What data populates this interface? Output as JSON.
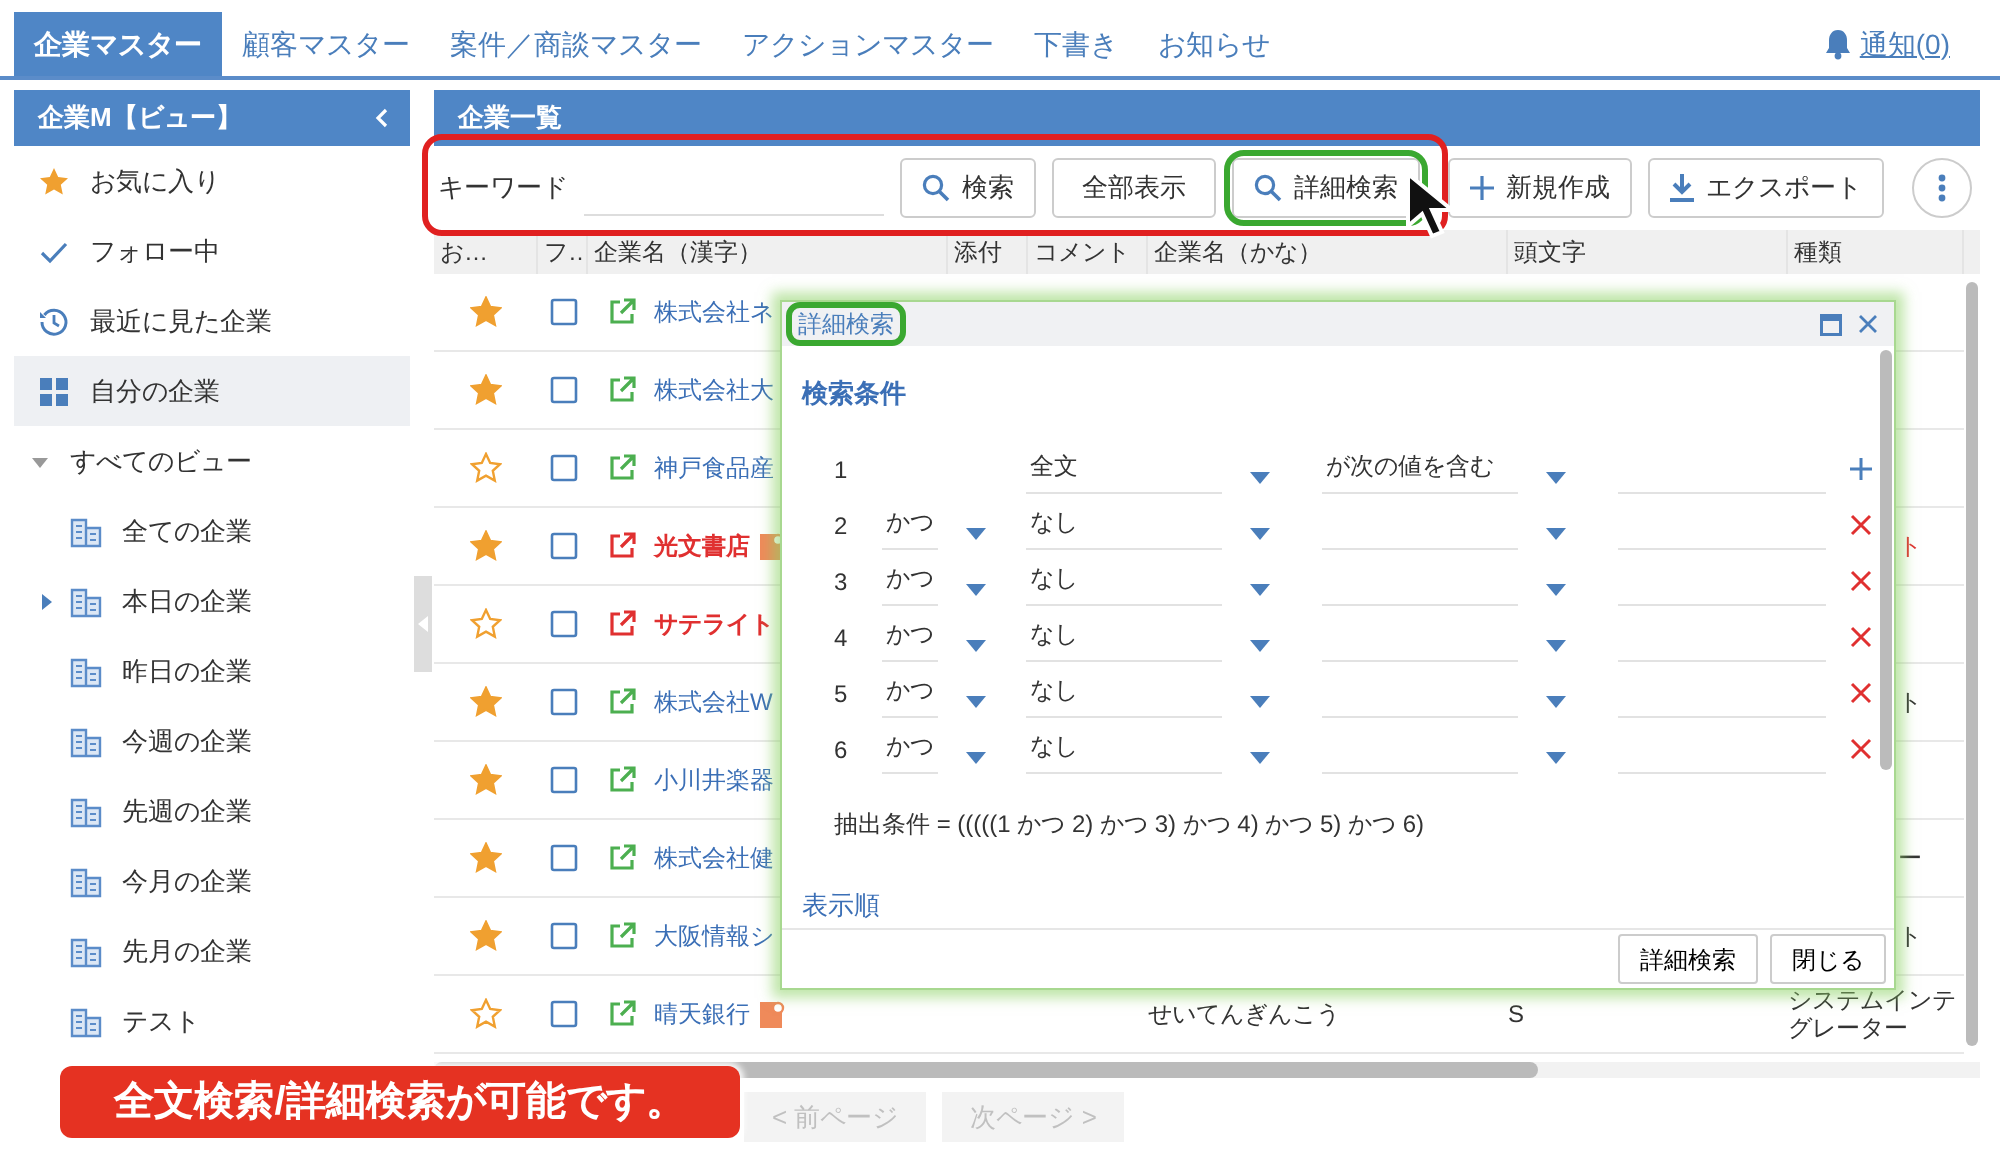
{
  "top_tabs": [
    {
      "label": "企業マスター",
      "selected": true
    },
    {
      "label": "顧客マスター",
      "selected": false
    },
    {
      "label": "案件／商談マスター",
      "selected": false
    },
    {
      "label": "アクションマスター",
      "selected": false
    },
    {
      "label": "下書き",
      "selected": false
    },
    {
      "label": "お知らせ",
      "selected": false
    }
  ],
  "notification": {
    "label": "通知(0)"
  },
  "sidebar": {
    "title": "企業M【ビュー】",
    "items": [
      {
        "label": "お気に入り",
        "kind": "favorites",
        "selected": false
      },
      {
        "label": "フォロー中",
        "kind": "following",
        "selected": false
      },
      {
        "label": "最近に見た企業",
        "kind": "recent",
        "selected": false
      },
      {
        "label": "自分の企業",
        "kind": "mine",
        "selected": true
      },
      {
        "label": "すべてのビュー",
        "kind": "group",
        "selected": false,
        "expanded": true,
        "children": [
          {
            "label": "全ての企業",
            "expandable": false,
            "selected": false
          },
          {
            "label": "本日の企業",
            "expandable": true,
            "selected": false
          },
          {
            "label": "昨日の企業",
            "expandable": false,
            "selected": false
          },
          {
            "label": "今週の企業",
            "expandable": false,
            "selected": false
          },
          {
            "label": "先週の企業",
            "expandable": false,
            "selected": false
          },
          {
            "label": "今月の企業",
            "expandable": false,
            "selected": false
          },
          {
            "label": "先月の企業",
            "expandable": false,
            "selected": false
          },
          {
            "label": "テスト",
            "expandable": false,
            "selected": false
          }
        ]
      }
    ]
  },
  "main": {
    "title": "企業一覧",
    "keyword_label": "キーワード",
    "toolbar": [
      {
        "label": "検索",
        "kind": "search"
      },
      {
        "label": "全部表示",
        "kind": "plain"
      },
      {
        "label": "詳細検索",
        "kind": "search"
      },
      {
        "label": "新規作成",
        "kind": "add"
      },
      {
        "label": "エクスポート",
        "kind": "export"
      }
    ],
    "table": {
      "columns": [
        "お…",
        "フ…",
        "企業名（漢字）",
        "添付",
        "コメント",
        "企業名（かな）",
        "頭文字",
        "種類"
      ],
      "rows": [
        {
          "favorite": true,
          "followed": false,
          "name": "株式会社ネ",
          "flagged": false
        },
        {
          "favorite": true,
          "followed": false,
          "name": "株式会社大",
          "flagged": false
        },
        {
          "favorite": false,
          "followed": false,
          "name": "神戸食品産",
          "flagged": false
        },
        {
          "favorite": true,
          "followed": false,
          "name": "光文書店",
          "flagged": true,
          "attachment": true,
          "type": "ト",
          "type_cut": true
        },
        {
          "favorite": false,
          "followed": false,
          "name": "サテライト",
          "flagged": true
        },
        {
          "favorite": true,
          "followed": false,
          "name": "株式会社W",
          "flagged": false,
          "type": "ト",
          "type_cut": true
        },
        {
          "favorite": true,
          "followed": false,
          "name": "小川井楽器",
          "flagged": false
        },
        {
          "favorite": true,
          "followed": false,
          "name": "株式会社健",
          "flagged": false,
          "type": "ー",
          "type_cut": true
        },
        {
          "favorite": true,
          "followed": false,
          "name": "大阪情報シ",
          "flagged": false,
          "type": "ト",
          "type_cut": true
        },
        {
          "favorite": false,
          "followed": false,
          "name": "晴天銀行",
          "flagged": false,
          "attachment": true,
          "kana": "せいてんぎんこう",
          "initial": "S",
          "type": "システムインテグレーター",
          "type_cut": false
        }
      ]
    },
    "pager": [
      {
        "label": "< 前ページ",
        "disabled": true
      },
      {
        "label": "次ページ >",
        "disabled": true
      }
    ]
  },
  "dialog": {
    "title": "詳細検索",
    "section": "検索条件",
    "conditions": [
      {
        "number": "1",
        "field": "全文",
        "operator": "が次の値を含む",
        "kind": "add"
      },
      {
        "number": "2",
        "conjunction": "かつ",
        "field": "なし",
        "kind": "remove"
      },
      {
        "number": "3",
        "conjunction": "かつ",
        "field": "なし",
        "kind": "remove"
      },
      {
        "number": "4",
        "conjunction": "かつ",
        "field": "なし",
        "kind": "remove"
      },
      {
        "number": "5",
        "conjunction": "かつ",
        "field": "なし",
        "kind": "remove"
      },
      {
        "number": "6",
        "conjunction": "かつ",
        "field": "なし",
        "kind": "remove"
      }
    ],
    "formula": "抽出条件 = (((((1 かつ 2) かつ 3) かつ 4) かつ 5) かつ 6)",
    "section2": "表示順",
    "buttons": [
      "詳細検索",
      "閉じる"
    ]
  },
  "callout": "全文検索/詳細検索が可能です。"
}
